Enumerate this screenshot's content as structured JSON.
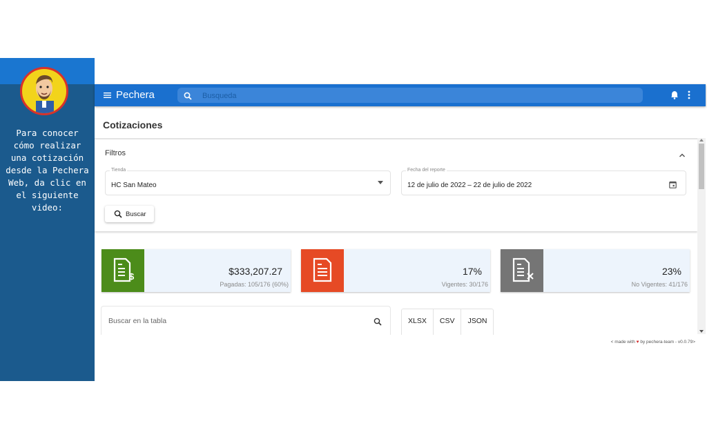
{
  "tutorial": {
    "text": "Para conocer\ncómo realizar\nuna cotización\ndesde la Pechera\nWeb, da clic en\nel siguiente\nvideo:"
  },
  "topbar": {
    "title": "Pechera",
    "search_placeholder": "Busqueda",
    "menu_icon": "menu-icon",
    "notifications_icon": "bell-icon",
    "more_icon": "kebab-icon"
  },
  "page": {
    "title": "Cotizaciones"
  },
  "filters": {
    "label": "Filtros",
    "store": {
      "label": "Tienda",
      "value": "HC San Mateo"
    },
    "date": {
      "label": "Fecha del reporte",
      "value": "12 de julio de 2022 – 22 de julio de 2022"
    },
    "search_button": "Buscar"
  },
  "cards": [
    {
      "value": "$333,207.27",
      "subtitle": "Pagadas: 105/176 (60%)",
      "color": "#4c8c1a",
      "icon": "paid-document-icon"
    },
    {
      "value": "17%",
      "subtitle": "Vigentes: 30/176",
      "color": "#e64a25",
      "icon": "document-icon"
    },
    {
      "value": "23%",
      "subtitle": "No Vigentes: 41/176",
      "color": "#757575",
      "icon": "cancelled-document-icon"
    }
  ],
  "table": {
    "search_placeholder": "Buscar en la tabla",
    "export": [
      "XLSX",
      "CSV",
      "JSON"
    ]
  },
  "footer": {
    "prefix": "< made with",
    "suffix": "by pechera-team - v0.0.79>"
  }
}
